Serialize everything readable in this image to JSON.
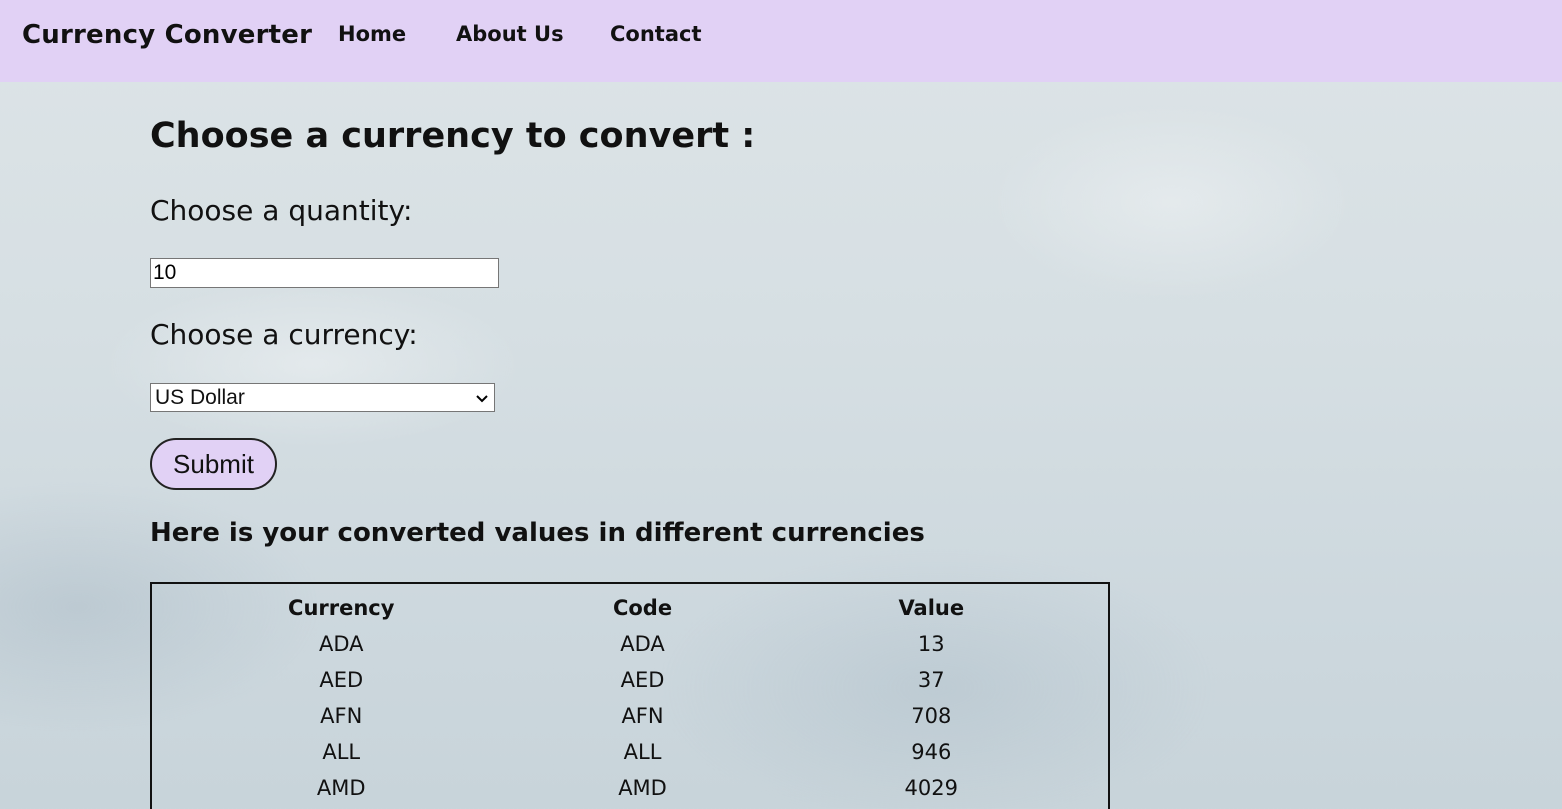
{
  "header": {
    "brand": "Currency Converter",
    "nav": [
      {
        "label": "Home"
      },
      {
        "label": "About Us"
      },
      {
        "label": "Contact"
      }
    ],
    "background_color": "#e1d1f5"
  },
  "form": {
    "title": "Choose a currency to convert :",
    "quantity_label": "Choose a quantity:",
    "quantity_value": "10",
    "currency_label": "Choose a currency:",
    "currency_selected": "US Dollar",
    "submit_label": "Submit"
  },
  "results": {
    "heading": "Here is your converted values in different currencies",
    "columns": [
      "Currency",
      "Code",
      "Value"
    ],
    "rows": [
      [
        "ADA",
        "ADA",
        "13"
      ],
      [
        "AED",
        "AED",
        "37"
      ],
      [
        "AFN",
        "AFN",
        "708"
      ],
      [
        "ALL",
        "ALL",
        "946"
      ],
      [
        "AMD",
        "AMD",
        "4029"
      ]
    ]
  }
}
